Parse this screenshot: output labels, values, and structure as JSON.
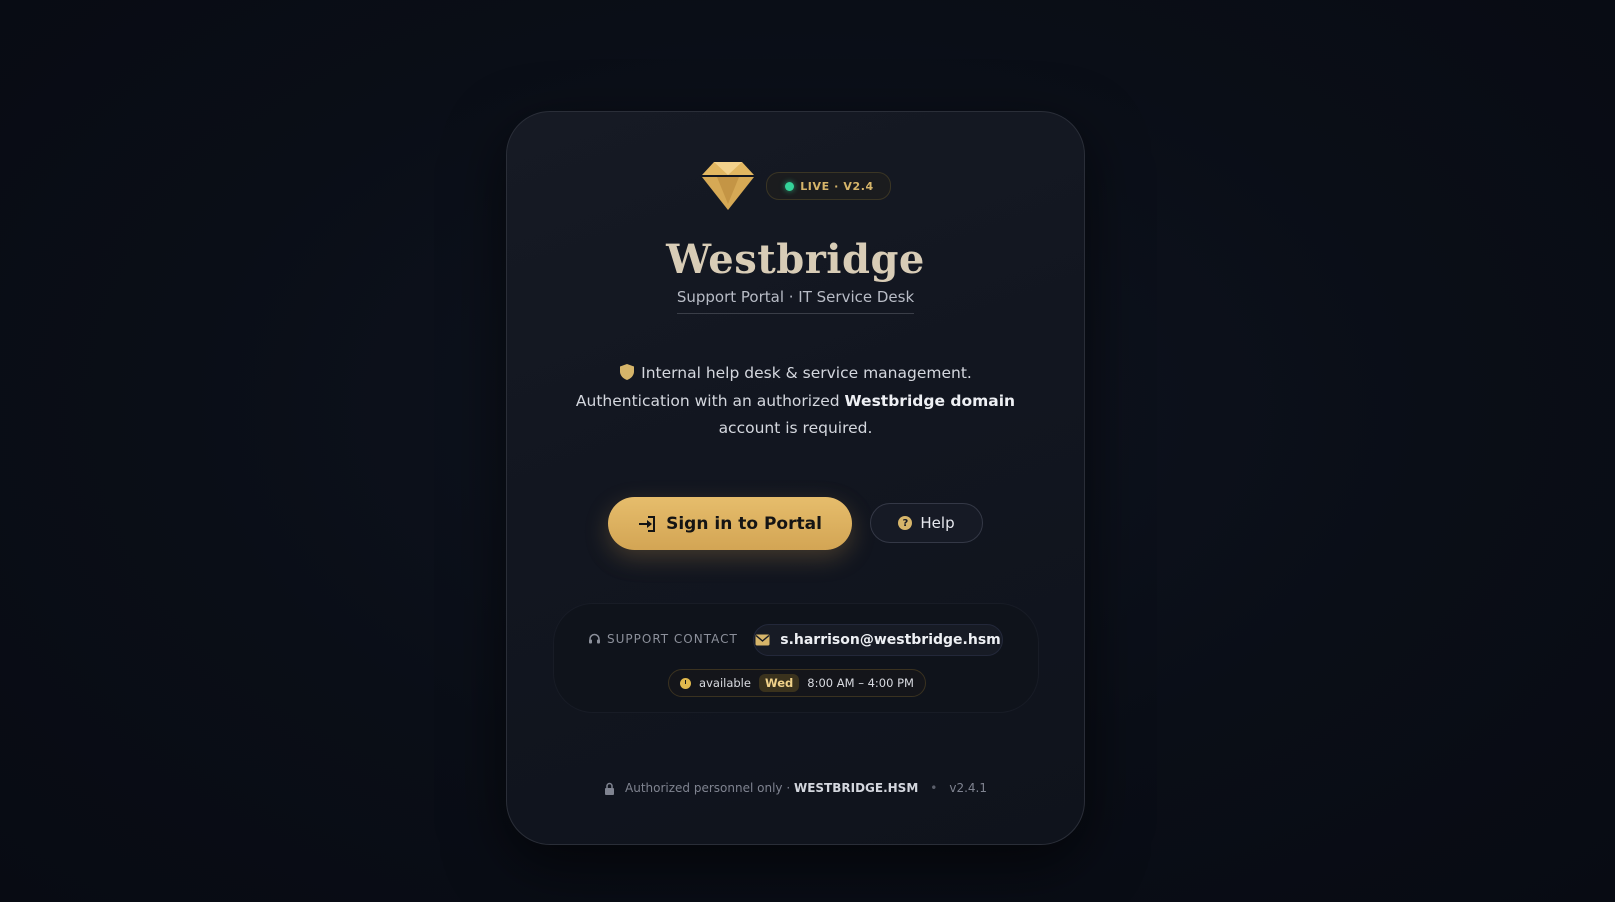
{
  "brand": {
    "name": "Westbridge",
    "subtitle": "Support Portal · IT Service Desk",
    "status_badge": "LIVE · V2.4",
    "status_color": "#34d399",
    "accent_color": "#d6b56a"
  },
  "description": {
    "line_prefix": "Internal help desk & service management.",
    "auth_prefix": "Authentication with an authorized ",
    "auth_bold": "Westbridge domain",
    "auth_suffix": " account is required."
  },
  "actions": {
    "signin_label": "Sign in to Portal",
    "help_label": "Help"
  },
  "support": {
    "label": "SUPPORT CONTACT",
    "email": "s.harrison@westbridge.hsm",
    "availability": "available",
    "day": "Wed",
    "hours": "8:00 AM – 4:00 PM"
  },
  "footer": {
    "notice": "Authorized personnel only · ",
    "domain": "WESTBRIDGE.HSM",
    "separator": "•",
    "version": "v2.4.1"
  }
}
